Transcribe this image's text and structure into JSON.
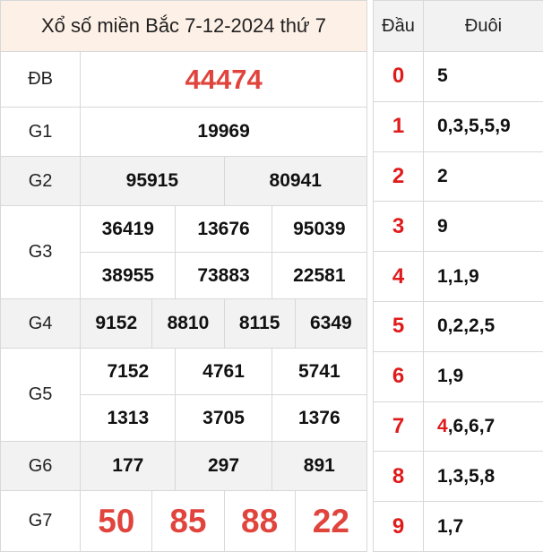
{
  "title": "Xổ số miền Bắc 7-12-2024 thứ 7",
  "prizes": {
    "db": {
      "label": "ĐB",
      "numbers": [
        "44474"
      ]
    },
    "g1": {
      "label": "G1",
      "numbers": [
        "19969"
      ]
    },
    "g2": {
      "label": "G2",
      "numbers": [
        "95915",
        "80941"
      ]
    },
    "g3": {
      "label": "G3",
      "numbers": [
        "36419",
        "13676",
        "95039",
        "38955",
        "73883",
        "22581"
      ]
    },
    "g4": {
      "label": "G4",
      "numbers": [
        "9152",
        "8810",
        "8115",
        "6349"
      ]
    },
    "g5": {
      "label": "G5",
      "numbers": [
        "7152",
        "4761",
        "5741",
        "1313",
        "3705",
        "1376"
      ]
    },
    "g6": {
      "label": "G6",
      "numbers": [
        "177",
        "297",
        "891"
      ]
    },
    "g7": {
      "label": "G7",
      "numbers": [
        "50",
        "85",
        "88",
        "22"
      ]
    }
  },
  "loto": {
    "head_label": "Đầu",
    "tail_label": "Đuôi",
    "rows": [
      {
        "head": "0",
        "tails": "5"
      },
      {
        "head": "1",
        "tails": "0,3,5,5,9"
      },
      {
        "head": "2",
        "tails": "2"
      },
      {
        "head": "3",
        "tails": "9"
      },
      {
        "head": "4",
        "tails": "1,1,9"
      },
      {
        "head": "5",
        "tails": "0,2,2,5"
      },
      {
        "head": "6",
        "tails": "1,9"
      },
      {
        "head": "7",
        "tails_highlight": "4",
        "tails_rest": ",6,6,7"
      },
      {
        "head": "8",
        "tails": "1,3,5,8"
      },
      {
        "head": "9",
        "tails": "1,7"
      }
    ]
  },
  "colors": {
    "accent_red": "#e0443d",
    "title_bg": "#fdf0e6",
    "shade_bg": "#f2f2f2",
    "border": "#d8d8d8"
  }
}
